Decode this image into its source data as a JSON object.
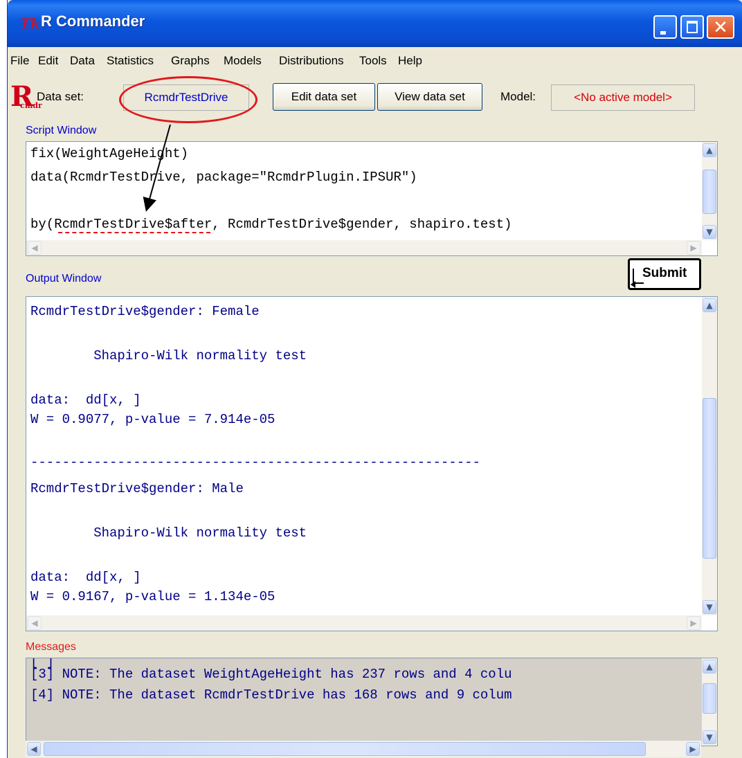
{
  "window": {
    "title": "R Commander",
    "icon": "Tk"
  },
  "menu": [
    "File",
    "Edit",
    "Data",
    "Statistics",
    "Graphs",
    "Models",
    "Distributions",
    "Tools",
    "Help"
  ],
  "toolbar": {
    "logo_big": "R",
    "logo_small": "cmdr",
    "dataset_label": "Data set:",
    "dataset_value": "RcmdrTestDrive",
    "edit_button": "Edit data set",
    "view_button": "View data set",
    "model_label": "Model:",
    "model_value": "<No active model>"
  },
  "script": {
    "label": "Script Window",
    "lines": [
      "fix(WeightAgeHeight)",
      "data(RcmdrTestDrive, package=\"RcmdrPlugin.IPSUR\")",
      "",
      "by(RcmdrTestDrive$after, RcmdrTestDrive$gender, shapiro.test)"
    ]
  },
  "output": {
    "label": "Output Window",
    "submit": "Submit",
    "lines": [
      "RcmdrTestDrive$gender: Female",
      "",
      "        Shapiro-Wilk normality test",
      "",
      "data:  dd[x, ]",
      "W = 0.9077, p-value = 7.914e-05",
      "",
      "---------------------------------------------------------",
      "RcmdrTestDrive$gender: Male",
      "",
      "        Shapiro-Wilk normality test",
      "",
      "data:  dd[x, ]",
      "W = 0.9167, p-value = 1.134e-05"
    ]
  },
  "messages": {
    "label": "Messages",
    "lines": [
      "[3] NOTE: The dataset WeightAgeHeight has 237 rows and 4 colu",
      "[4] NOTE: The dataset RcmdrTestDrive has 168 rows and 9 colum"
    ]
  },
  "colors": {
    "accent_blue": "#0000cc",
    "message_red": "#d8000a",
    "annotation_red": "#e2181c"
  }
}
